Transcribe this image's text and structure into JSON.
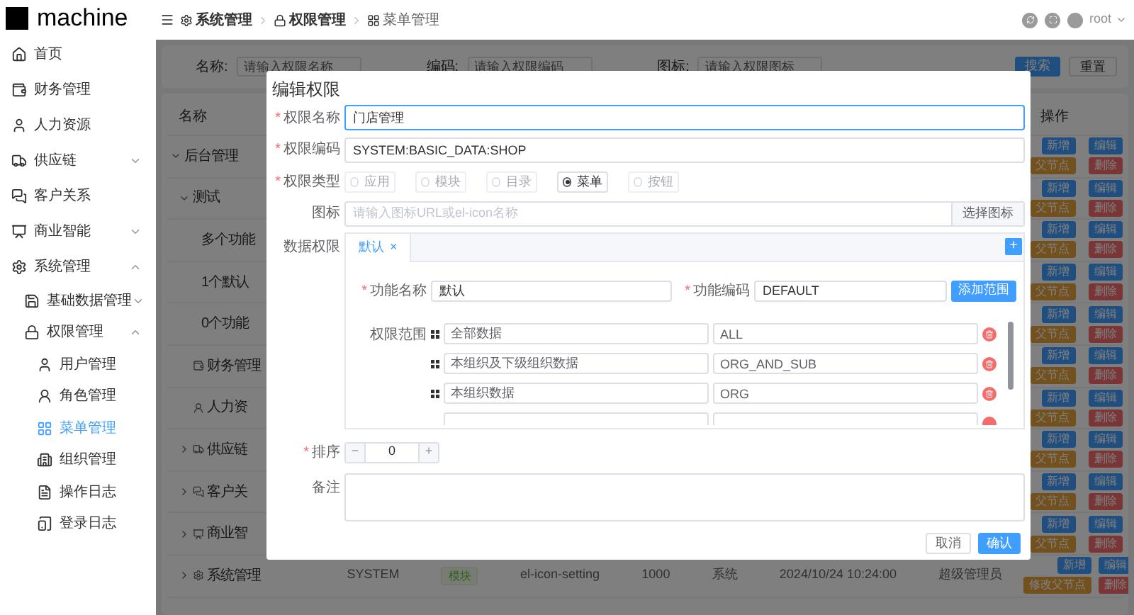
{
  "logo": {
    "text": "machine"
  },
  "sidebar": {
    "items": [
      {
        "label": "首页",
        "selected": false
      },
      {
        "label": "财务管理",
        "selected": false
      },
      {
        "label": "人力资源",
        "selected": false
      },
      {
        "label": "供应链",
        "selected": false,
        "expanded": false
      },
      {
        "label": "客户关系",
        "selected": false
      },
      {
        "label": "商业智能",
        "selected": false,
        "expanded": false
      },
      {
        "label": "系统管理",
        "selected": false,
        "expanded": true,
        "children": [
          {
            "label": "基础数据管理",
            "selected": false,
            "expanded": false
          },
          {
            "label": "权限管理",
            "selected": false,
            "expanded": true,
            "children": [
              {
                "label": "用户管理",
                "selected": false
              },
              {
                "label": "角色管理",
                "selected": false
              },
              {
                "label": "菜单管理",
                "selected": true
              },
              {
                "label": "组织管理",
                "selected": false
              },
              {
                "label": "操作日志",
                "selected": false
              },
              {
                "label": "登录日志",
                "selected": false
              }
            ]
          }
        ]
      }
    ]
  },
  "breadcrumb": [
    "系统管理",
    "权限管理",
    "菜单管理"
  ],
  "user": {
    "name": "root"
  },
  "search": {
    "fields": [
      {
        "label": "名称:",
        "placeholder": "请输入权限名称"
      },
      {
        "label": "编码:",
        "placeholder": "请输入权限编码"
      },
      {
        "label": "图标:",
        "placeholder": "请输入权限图标"
      }
    ],
    "buttons": [
      {
        "label": "搜索",
        "primary": true
      },
      {
        "label": "重置",
        "primary": false
      }
    ]
  },
  "table": {
    "columns": {
      "name": "名称",
      "actions": "操作"
    },
    "rows": [
      {
        "name": "后台管理",
        "expanded": true,
        "actions": [
          "新增",
          "编辑",
          "父节点",
          "删除"
        ],
        "children": [
          {
            "name": "测试",
            "expanded": true,
            "actions": [
              "新增",
              "编辑",
              "父节点",
              "删除"
            ],
            "children": [
              {
                "name": "多个功能",
                "actions": [
                  "新增",
                  "编辑",
                  "父节点",
                  "删除"
                ]
              },
              {
                "name": "1个默认",
                "actions": [
                  "新增",
                  "编辑",
                  "父节点",
                  "删除"
                ]
              },
              {
                "name": "0个功能",
                "actions": [
                  "新增",
                  "编辑",
                  "父节点",
                  "删除"
                ]
              }
            ]
          },
          {
            "name": "财务管理",
            "actions": [
              "新增",
              "编辑",
              "父节点",
              "删除"
            ]
          },
          {
            "name": "人力资",
            "actions": [
              "新增",
              "编辑",
              "父节点",
              "删除"
            ]
          },
          {
            "name": "供应链",
            "expanded": false,
            "actions": [
              "新增",
              "编辑",
              "父节点",
              "删除"
            ]
          },
          {
            "name": "客户关",
            "expanded": false,
            "actions": [
              "新增",
              "编辑",
              "父节点",
              "删除"
            ]
          },
          {
            "name": "商业智",
            "expanded": false,
            "actions": [
              "新增",
              "编辑",
              "父节点",
              "删除"
            ]
          },
          {
            "name": "系统管理",
            "expanded": false,
            "cells": [
              {
                "kind": "text",
                "text": "SYSTEM"
              },
              {
                "kind": "tag",
                "text": "模块"
              },
              {
                "kind": "text",
                "text": "el-icon-setting"
              },
              {
                "kind": "text",
                "text": "1000"
              },
              {
                "kind": "text",
                "text": "系统"
              },
              {
                "kind": "text",
                "text": "2024/10/24 10:24:00"
              },
              {
                "kind": "text",
                "text": "超级管理员"
              }
            ],
            "actions": [
              "新增",
              "编辑",
              "修改父节点",
              "删除"
            ]
          }
        ]
      }
    ]
  },
  "dialog": {
    "title": "编辑权限",
    "name": {
      "label": "权限名称",
      "mark": "*",
      "value": "门店管理"
    },
    "code": {
      "label": "权限编码",
      "mark": "*",
      "value": "SYSTEM:BASIC_DATA:SHOP"
    },
    "type": {
      "label": "权限类型",
      "mark": "*",
      "options": [
        {
          "label": "应用",
          "selected": false
        },
        {
          "label": "模块",
          "selected": false
        },
        {
          "label": "目录",
          "selected": false
        },
        {
          "label": "菜单",
          "selected": true
        },
        {
          "label": "按钮",
          "selected": false
        }
      ]
    },
    "icon": {
      "label": "图标",
      "placeholder": "请输入图标URL或el-icon名称",
      "button": "选择图标"
    },
    "data_permission": {
      "label": "数据权限",
      "tabs": [
        {
          "label": "默认",
          "selected": true,
          "close": "×"
        }
      ],
      "add": "+",
      "function_name": {
        "label": "功能名称",
        "mark": "*",
        "value": "默认"
      },
      "function_code": {
        "label": "功能编码",
        "mark": "*",
        "value": "DEFAULT"
      },
      "add_scope": "添加范围",
      "scope_label": "权限范围",
      "scopes": [
        {
          "kind": "row",
          "name": "全部数据",
          "code": "ALL"
        },
        {
          "kind": "row",
          "name": "本组织及下级组织数据",
          "code": "ORG_AND_SUB"
        },
        {
          "kind": "row",
          "name": "本组织数据",
          "code": "ORG"
        },
        {
          "kind": "clipped"
        }
      ]
    },
    "sort": {
      "label": "排序",
      "mark": "*",
      "minus": "−",
      "value": "0",
      "plus": "+"
    },
    "remark": {
      "label": "备注"
    },
    "buttons": [
      {
        "label": "取消",
        "primary": false
      },
      {
        "label": "确认",
        "primary": true
      }
    ]
  }
}
